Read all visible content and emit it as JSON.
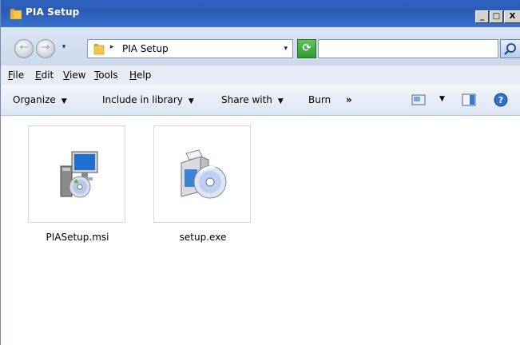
{
  "window": {
    "title": "PIA Setup",
    "controls": {
      "minimize": "_",
      "maximize": "□",
      "close": "X"
    }
  },
  "address": {
    "path": "PIA Setup",
    "breadcrumb_sep": "▸",
    "dropdown_glyph": "▾",
    "search_placeholder": ""
  },
  "menu": {
    "items": [
      {
        "label": "File",
        "accel": "F"
      },
      {
        "label": "Edit",
        "accel": "E"
      },
      {
        "label": "View",
        "accel": "V"
      },
      {
        "label": "Tools",
        "accel": "T"
      },
      {
        "label": "Help",
        "accel": "H"
      }
    ]
  },
  "commands": {
    "organize": "Organize",
    "include_in_library": "Include in library",
    "share_with": "Share with",
    "burn": "Burn",
    "more": "»"
  },
  "files": [
    {
      "name": "PIASetup.msi",
      "icon": "msi-installer-icon"
    },
    {
      "name": "setup.exe",
      "icon": "setup-exe-icon"
    }
  ],
  "colors": {
    "titlebar": "#2e63c0",
    "accent_green": "#2f9a2b",
    "folder": "#f2c94c"
  }
}
